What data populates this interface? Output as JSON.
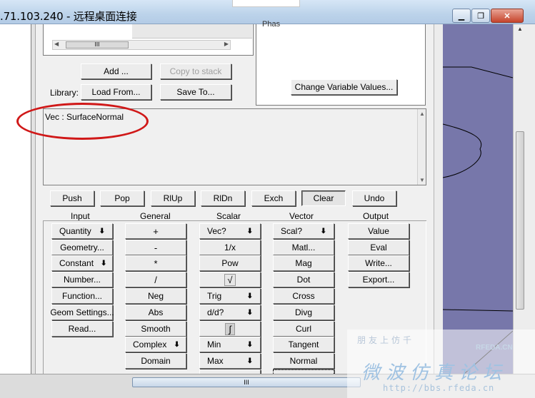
{
  "window": {
    "title": ".71.103.240 - 远程桌面连接",
    "min_label": "▁",
    "restore_label": "❐",
    "close_label": "✕"
  },
  "top_list": {
    "scroll_thumb": "III"
  },
  "middle_box": {
    "partial_text": "Phas"
  },
  "stack_buttons": {
    "add": "Add ...",
    "copy_to_stack": "Copy to stack"
  },
  "library": {
    "label": "Library:",
    "load_from": "Load From...",
    "save_to": "Save To..."
  },
  "change_variable_values": "Change Variable Values...",
  "register": {
    "text": "Vec : SurfaceNormal"
  },
  "stack_ops": {
    "push": "Push",
    "pop": "Pop",
    "rlup": "RlUp",
    "rldn": "RlDn",
    "exch": "Exch",
    "clear": "Clear",
    "undo": "Undo"
  },
  "columns": {
    "input": "Input",
    "general": "General",
    "scalar": "Scalar",
    "vector": "Vector",
    "output": "Output"
  },
  "input_buttons": {
    "quantity": "Quantity",
    "geometry": "Geometry...",
    "constant": "Constant",
    "number": "Number...",
    "function": "Function...",
    "geom_settings": "Geom Settings...",
    "read": "Read..."
  },
  "general_buttons": {
    "plus": "+",
    "minus": "-",
    "times": "*",
    "divide": "/",
    "neg": "Neg",
    "abs": "Abs",
    "smooth": "Smooth",
    "complex": "Complex",
    "domain": "Domain"
  },
  "scalar_buttons": {
    "vec": "Vec?",
    "reciprocal": "1/x",
    "pow": "Pow",
    "sqrt": "√",
    "trig": "Trig",
    "deriv": "d/d?",
    "integral": "∫",
    "min": "Min",
    "max": "Max"
  },
  "vector_buttons": {
    "scal": "Scal?",
    "matl": "Matl...",
    "mag": "Mag",
    "dot": "Dot",
    "cross": "Cross",
    "divg": "Divg",
    "curl": "Curl",
    "tangent": "Tangent",
    "normal": "Normal"
  },
  "output_buttons": {
    "value": "Value",
    "eval": "Eval",
    "write": "Write...",
    "export": "Export..."
  },
  "dropdown_arrow": "🡇",
  "bottom_scroll_thumb": "III",
  "watermark": {
    "line1": "朋友上仿千",
    "brand": "RFEDA.CN",
    "line2": "微波仿真论坛",
    "url": "http://bbs.rfeda.cn"
  },
  "colors": {
    "mesh_background": "#7777aa",
    "annotation_red": "#d01818"
  }
}
